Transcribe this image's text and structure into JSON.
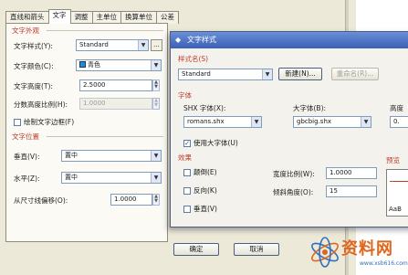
{
  "back_dialog": {
    "tabs": [
      "直线和箭头",
      "文字",
      "调整",
      "主单位",
      "换算单位",
      "公差"
    ],
    "text_appearance": {
      "section_title": "文字外观",
      "style_label": "文字样式(Y):",
      "style_value": "Standard",
      "style_button": "...",
      "color_label": "文字颜色(C):",
      "color_value": "青色",
      "height_label": "文字高度(T):",
      "height_value": "2.5000",
      "fraction_label": "分数高度比例(H):",
      "fraction_value": "1.0000",
      "frame_label": "绘制文字边框(F)"
    },
    "text_placement": {
      "section_title": "文字位置",
      "vertical_label": "垂直(V):",
      "vertical_value": "置中",
      "horizontal_label": "水平(Z):",
      "horizontal_value": "置中",
      "offset_label": "从尺寸线偏移(O):",
      "offset_value": "1.0000"
    },
    "buttons": {
      "ok": "确定",
      "cancel": "取消"
    }
  },
  "front_dialog": {
    "title": "文字样式",
    "style_name_section": "样式名(S)",
    "style_name_value": "Standard",
    "new_button": "新建(N)...",
    "rename_button": "重命名(R)...",
    "font_section": "字体",
    "shx_label": "SHX 字体(X):",
    "shx_value": "romans.shx",
    "bigfont_label": "大字体(B):",
    "bigfont_value": "gbcbig.shx",
    "height_label_cut": "高度",
    "height_value_cut": "0.",
    "use_bigfont_label": "使用大字体(U)",
    "use_bigfont_checked": true,
    "effects_section": "效果",
    "upside_down_label": "颠倒(E)",
    "backwards_label": "反向(K)",
    "vertical_label": "垂直(V)",
    "width_factor_label": "宽度比例(W):",
    "width_factor_value": "1.0000",
    "oblique_label": "倾斜角度(O):",
    "oblique_value": "15",
    "preview_section": "预览",
    "preview_text": "AaB"
  },
  "watermark": {
    "brand": "资料网",
    "url": "www.xsb616.com"
  },
  "colors": {
    "cyan_swatch": "#1a8fd8",
    "section_red": "#c03a2b",
    "title_blue": "#3a5fb6",
    "brand_orange": "#e0661e"
  }
}
